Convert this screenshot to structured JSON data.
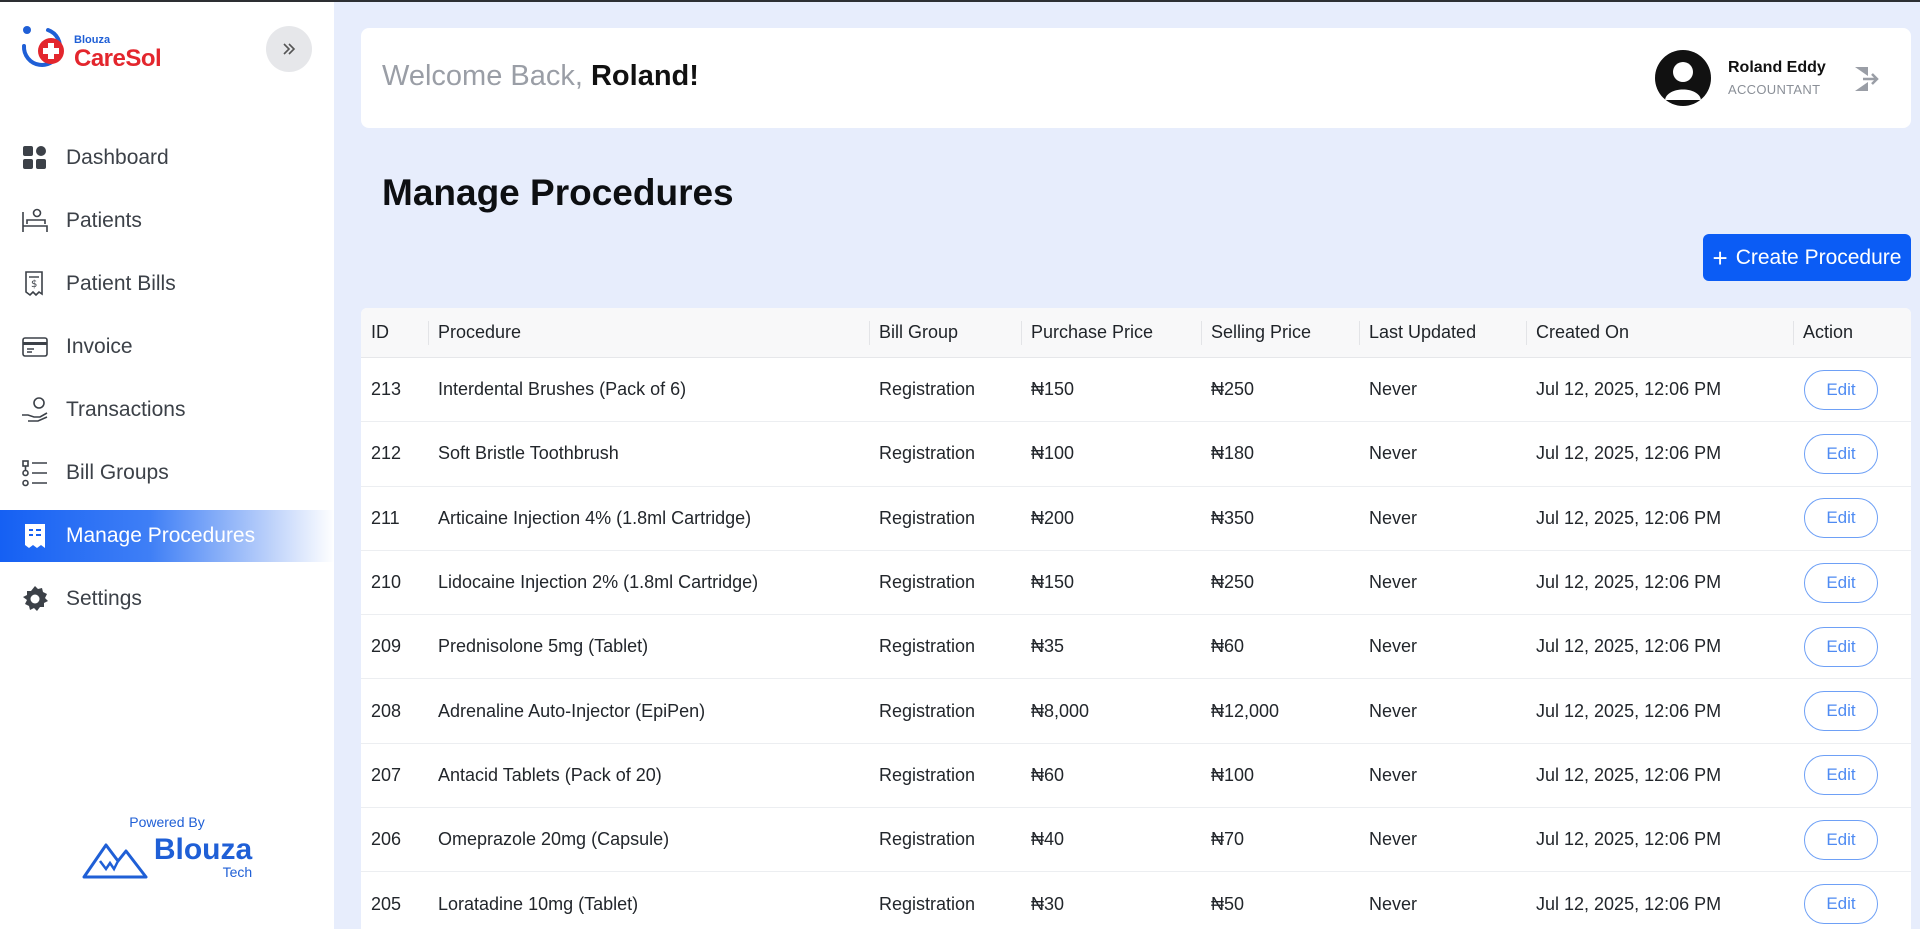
{
  "brand": {
    "small": "Blouza",
    "name": "CareSol"
  },
  "sidebar": {
    "items": [
      {
        "label": "Dashboard",
        "icon": "dashboard-icon"
      },
      {
        "label": "Patients",
        "icon": "patients-bed-icon"
      },
      {
        "label": "Patient Bills",
        "icon": "bill-receipt-icon"
      },
      {
        "label": "Invoice",
        "icon": "invoice-icon"
      },
      {
        "label": "Transactions",
        "icon": "transactions-hand-coin-icon"
      },
      {
        "label": "Bill Groups",
        "icon": "bill-groups-list-icon"
      },
      {
        "label": "Manage Procedures",
        "icon": "procedures-receipt-icon",
        "active": true
      },
      {
        "label": "Settings",
        "icon": "gear-icon"
      }
    ],
    "powered_by": "Powered By",
    "footer_brand": "Blouza",
    "footer_brand_sub": "Tech"
  },
  "header": {
    "welcome_prefix": "Welcome Back, ",
    "welcome_name": "Roland!",
    "user_name": "Roland Eddy",
    "user_role": "ACCOUNTANT"
  },
  "page": {
    "title": "Manage Procedures",
    "create_button": "Create Procedure"
  },
  "table": {
    "columns": [
      "ID",
      "Procedure",
      "Bill Group",
      "Purchase Price",
      "Selling Price",
      "Last Updated",
      "Created On",
      "Action"
    ],
    "edit_label": "Edit",
    "rows": [
      {
        "id": "213",
        "procedure": "Interdental Brushes (Pack of 6)",
        "group": "Registration",
        "purchase": "₦150",
        "selling": "₦250",
        "updated": "Never",
        "created": "Jul 12, 2025, 12:06 PM"
      },
      {
        "id": "212",
        "procedure": "Soft Bristle Toothbrush",
        "group": "Registration",
        "purchase": "₦100",
        "selling": "₦180",
        "updated": "Never",
        "created": "Jul 12, 2025, 12:06 PM"
      },
      {
        "id": "211",
        "procedure": "Articaine Injection 4% (1.8ml Cartridge)",
        "group": "Registration",
        "purchase": "₦200",
        "selling": "₦350",
        "updated": "Never",
        "created": "Jul 12, 2025, 12:06 PM"
      },
      {
        "id": "210",
        "procedure": "Lidocaine Injection 2% (1.8ml Cartridge)",
        "group": "Registration",
        "purchase": "₦150",
        "selling": "₦250",
        "updated": "Never",
        "created": "Jul 12, 2025, 12:06 PM"
      },
      {
        "id": "209",
        "procedure": "Prednisolone 5mg (Tablet)",
        "group": "Registration",
        "purchase": "₦35",
        "selling": "₦60",
        "updated": "Never",
        "created": "Jul 12, 2025, 12:06 PM"
      },
      {
        "id": "208",
        "procedure": "Adrenaline Auto-Injector (EpiPen)",
        "group": "Registration",
        "purchase": "₦8,000",
        "selling": "₦12,000",
        "updated": "Never",
        "created": "Jul 12, 2025, 12:06 PM"
      },
      {
        "id": "207",
        "procedure": "Antacid Tablets (Pack of 20)",
        "group": "Registration",
        "purchase": "₦60",
        "selling": "₦100",
        "updated": "Never",
        "created": "Jul 12, 2025, 12:06 PM"
      },
      {
        "id": "206",
        "procedure": "Omeprazole 20mg (Capsule)",
        "group": "Registration",
        "purchase": "₦40",
        "selling": "₦70",
        "updated": "Never",
        "created": "Jul 12, 2025, 12:06 PM"
      },
      {
        "id": "205",
        "procedure": "Loratadine 10mg (Tablet)",
        "group": "Registration",
        "purchase": "₦30",
        "selling": "₦50",
        "updated": "Never",
        "created": "Jul 12, 2025, 12:06 PM"
      }
    ]
  },
  "colors": {
    "accent": "#0b5cf5",
    "brand_red": "#e3262d",
    "page_bg": "#e7edfc"
  }
}
